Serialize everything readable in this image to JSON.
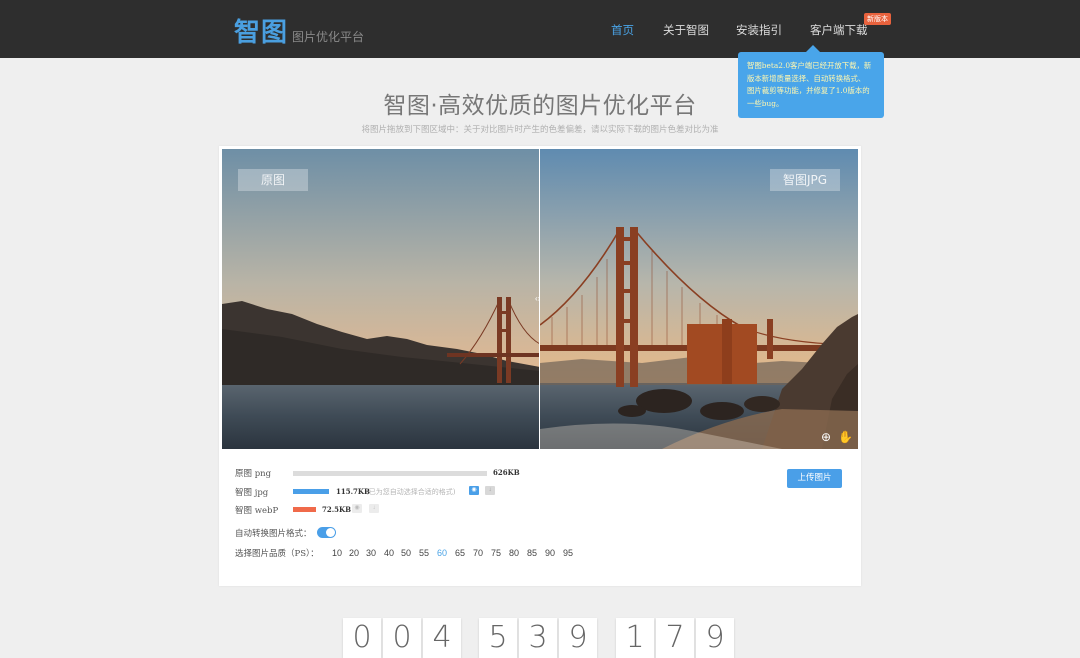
{
  "header": {
    "logo": "智图",
    "logo_subtitle": "图片优化平台",
    "nav": [
      {
        "label": "首页",
        "active": true
      },
      {
        "label": "关于智图",
        "active": false
      },
      {
        "label": "安装指引",
        "active": false
      },
      {
        "label": "客户端下载",
        "active": false
      }
    ],
    "new_badge": "新版本"
  },
  "tooltip": {
    "lines": [
      "智图beta2.0客户端已经开放下载，新",
      "版本新增质量选择、自动转换格式、",
      "图片裁剪等功能，并修复了1.0版本的",
      "一些bug。"
    ]
  },
  "hero": {
    "title": "智图·高效优质的图片优化平台",
    "subtitle": "将图片拖放到下图区域中：关于对比图片时产生的色差偏差，请以实际下载的图片色差对比为准"
  },
  "viewer": {
    "left_label": "原图",
    "right_label": "智图JPG"
  },
  "stats": {
    "rows": [
      {
        "label": "原图 png",
        "size": "626KB",
        "fill_fraction": 1.0,
        "color": "#dcdcdc"
      },
      {
        "label": "智图 jpg",
        "size": "115.7KB",
        "note": "(已为您自动选择合适的格式)",
        "fill_fraction": 0.185,
        "color": "#4a9fe8"
      },
      {
        "label": "智图 webP",
        "size": "72.5KB",
        "fill_fraction": 0.116,
        "color": "#f06a4a"
      }
    ],
    "upload_label": "上传图片",
    "auto_convert_label": "自动转换图片格式：",
    "auto_convert_on": true,
    "quality_label": "选择图片品质（PS）：",
    "quality_options": [
      "10",
      "20",
      "30",
      "40",
      "50",
      "55",
      "60",
      "65",
      "70",
      "75",
      "80",
      "85",
      "90",
      "95"
    ],
    "quality_selected": "60"
  },
  "counter": {
    "digits": [
      "0",
      "0",
      "4",
      "5",
      "3",
      "9",
      "1",
      "7",
      "9"
    ]
  },
  "colors": {
    "header_bg": "#2e2e2e",
    "accent": "#4a9fe8",
    "tooltip_bg": "#49a5ea",
    "badge": "#e8623d"
  }
}
